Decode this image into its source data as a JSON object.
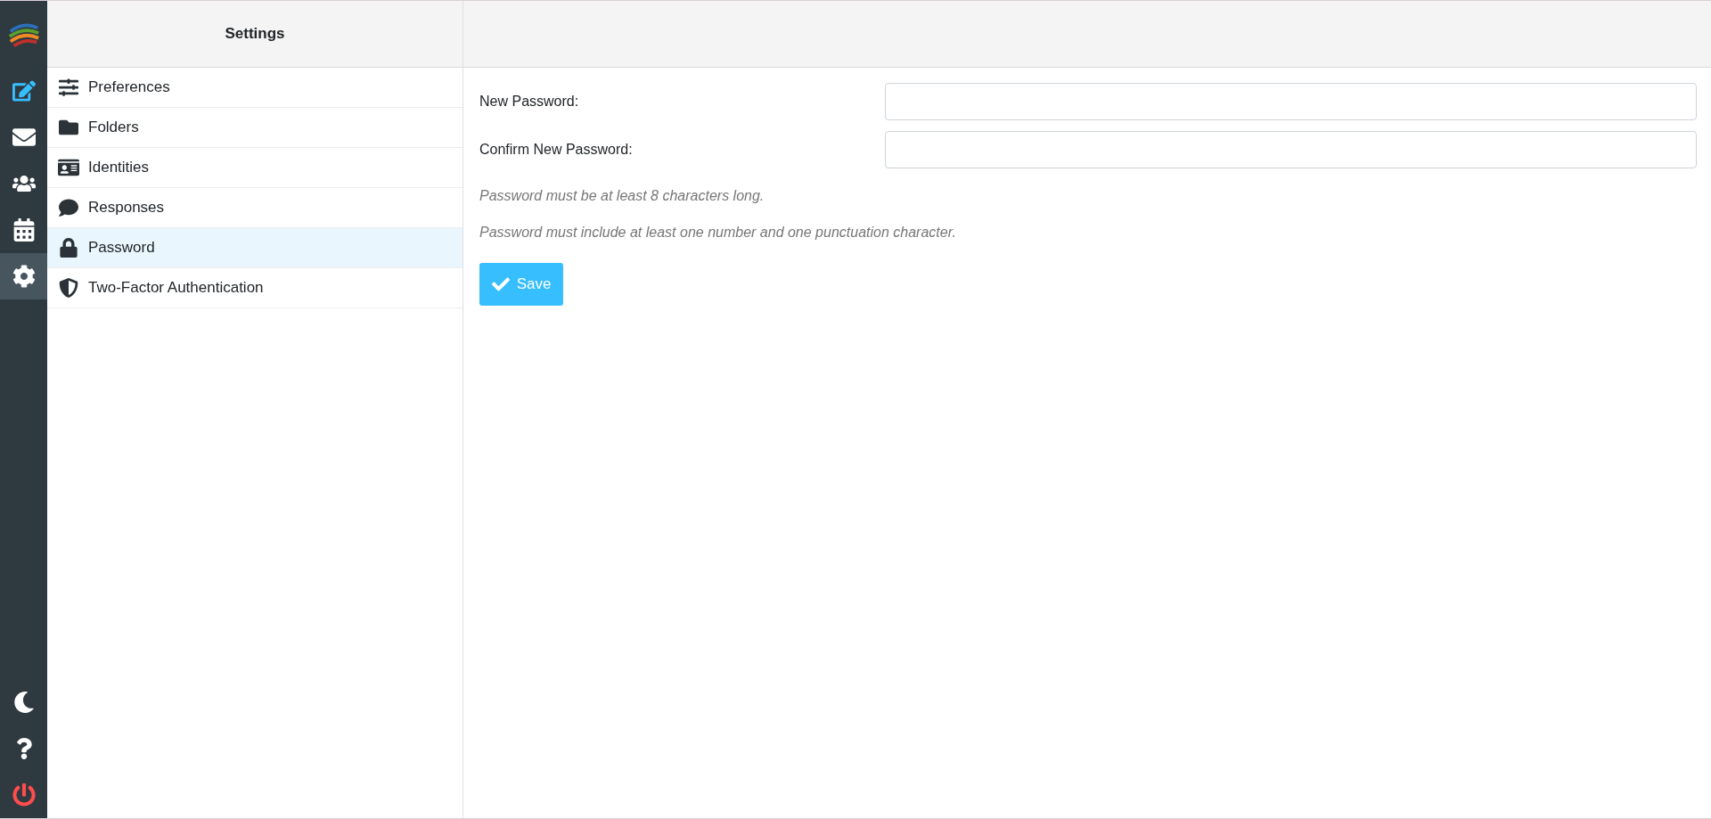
{
  "nav_rail": {
    "top_items": [
      {
        "selected": false
      },
      {
        "selected": false
      },
      {
        "selected": false
      },
      {
        "selected": false
      },
      {
        "selected": true
      }
    ]
  },
  "settings_panel": {
    "title": "Settings",
    "items": [
      {
        "label": "Preferences",
        "selected": false
      },
      {
        "label": "Folders",
        "selected": false
      },
      {
        "label": "Identities",
        "selected": false
      },
      {
        "label": "Responses",
        "selected": false
      },
      {
        "label": "Password",
        "selected": true
      },
      {
        "label": "Two-Factor Authentication",
        "selected": false
      }
    ]
  },
  "form": {
    "fields": [
      {
        "label": "New Password:"
      },
      {
        "label": "Confirm New Password:"
      }
    ],
    "hints": [
      "Password must be at least 8 characters long.",
      "Password must include at least one number and one punctuation character."
    ],
    "save_button": "Save"
  }
}
